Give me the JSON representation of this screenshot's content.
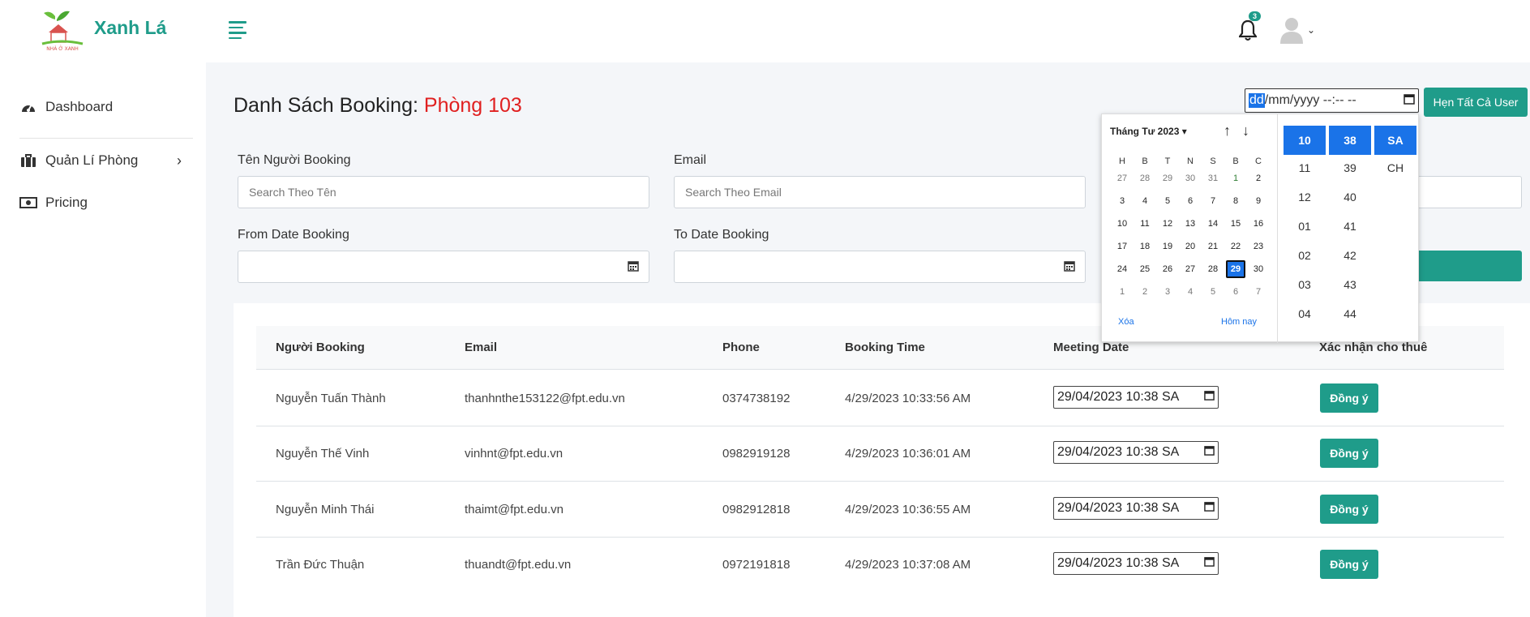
{
  "brand": {
    "name": "Xanh Lá",
    "logo_caption": "NHÀ Ở XANH"
  },
  "sidebar": {
    "items": [
      {
        "label": "Dashboard"
      },
      {
        "label": "Quản Lí Phòng"
      },
      {
        "label": "Pricing"
      }
    ]
  },
  "header": {
    "notification_count": "3"
  },
  "page": {
    "title": "Danh Sách Booking:",
    "room": "Phòng 103",
    "datetime_placeholder_dd": "dd",
    "datetime_placeholder_rest": "/mm/yyyy --:-- --",
    "schedule_all_button": "Hẹn Tất Cả User"
  },
  "filters": {
    "name_label": "Tên Người Booking",
    "name_placeholder": "Search Theo Tên",
    "email_label": "Email",
    "email_placeholder": "Search Theo Email",
    "from_label": "From Date Booking",
    "to_label": "To Date Booking"
  },
  "table": {
    "headers": [
      "Người Booking",
      "Email",
      "Phone",
      "Booking Time",
      "Meeting Date",
      "Xác nhận cho thuê"
    ],
    "rows": [
      {
        "name": "Nguyễn Tuấn Thành",
        "email": "thanhnthe153122@fpt.edu.vn",
        "phone": "0374738192",
        "booking_time": "4/29/2023 10:33:56 AM",
        "meeting_date": "29/04/2023 10:38 SA",
        "action": "Đồng ý"
      },
      {
        "name": "Nguyễn Thế Vinh",
        "email": "vinhnt@fpt.edu.vn",
        "phone": "0982919128",
        "booking_time": "4/29/2023 10:36:01 AM",
        "meeting_date": "29/04/2023 10:38 SA",
        "action": "Đồng ý"
      },
      {
        "name": "Nguyễn Minh Thái",
        "email": "thaimt@fpt.edu.vn",
        "phone": "0982912818",
        "booking_time": "4/29/2023 10:36:55 AM",
        "meeting_date": "29/04/2023 10:38 SA",
        "action": "Đồng ý"
      },
      {
        "name": "Trần Đức Thuận",
        "email": "thuandt@fpt.edu.vn",
        "phone": "0972191818",
        "booking_time": "4/29/2023 10:37:08 AM",
        "meeting_date": "29/04/2023 10:38 SA",
        "action": "Đồng ý"
      }
    ]
  },
  "picker": {
    "month_label": "Tháng Tư 2023 ▾",
    "weekdays": [
      "H",
      "B",
      "T",
      "N",
      "S",
      "B",
      "C"
    ],
    "weeks": [
      [
        "27",
        "28",
        "29",
        "30",
        "31",
        "1",
        "2"
      ],
      [
        "3",
        "4",
        "5",
        "6",
        "7",
        "8",
        "9"
      ],
      [
        "10",
        "11",
        "12",
        "13",
        "14",
        "15",
        "16"
      ],
      [
        "17",
        "18",
        "19",
        "20",
        "21",
        "22",
        "23"
      ],
      [
        "24",
        "25",
        "26",
        "27",
        "28",
        "29",
        "30"
      ],
      [
        "1",
        "2",
        "3",
        "4",
        "5",
        "6",
        "7"
      ]
    ],
    "selected_day": "29",
    "clear_label": "Xóa",
    "today_label": "Hôm nay",
    "hours": [
      "10",
      "11",
      "12",
      "01",
      "02",
      "03",
      "04"
    ],
    "minutes": [
      "38",
      "39",
      "40",
      "41",
      "42",
      "43",
      "44"
    ],
    "periods": [
      "SA",
      "CH"
    ]
  },
  "colors": {
    "accent": "#1f9c8a",
    "room": "#e02020",
    "picker_select": "#1a73e8"
  }
}
